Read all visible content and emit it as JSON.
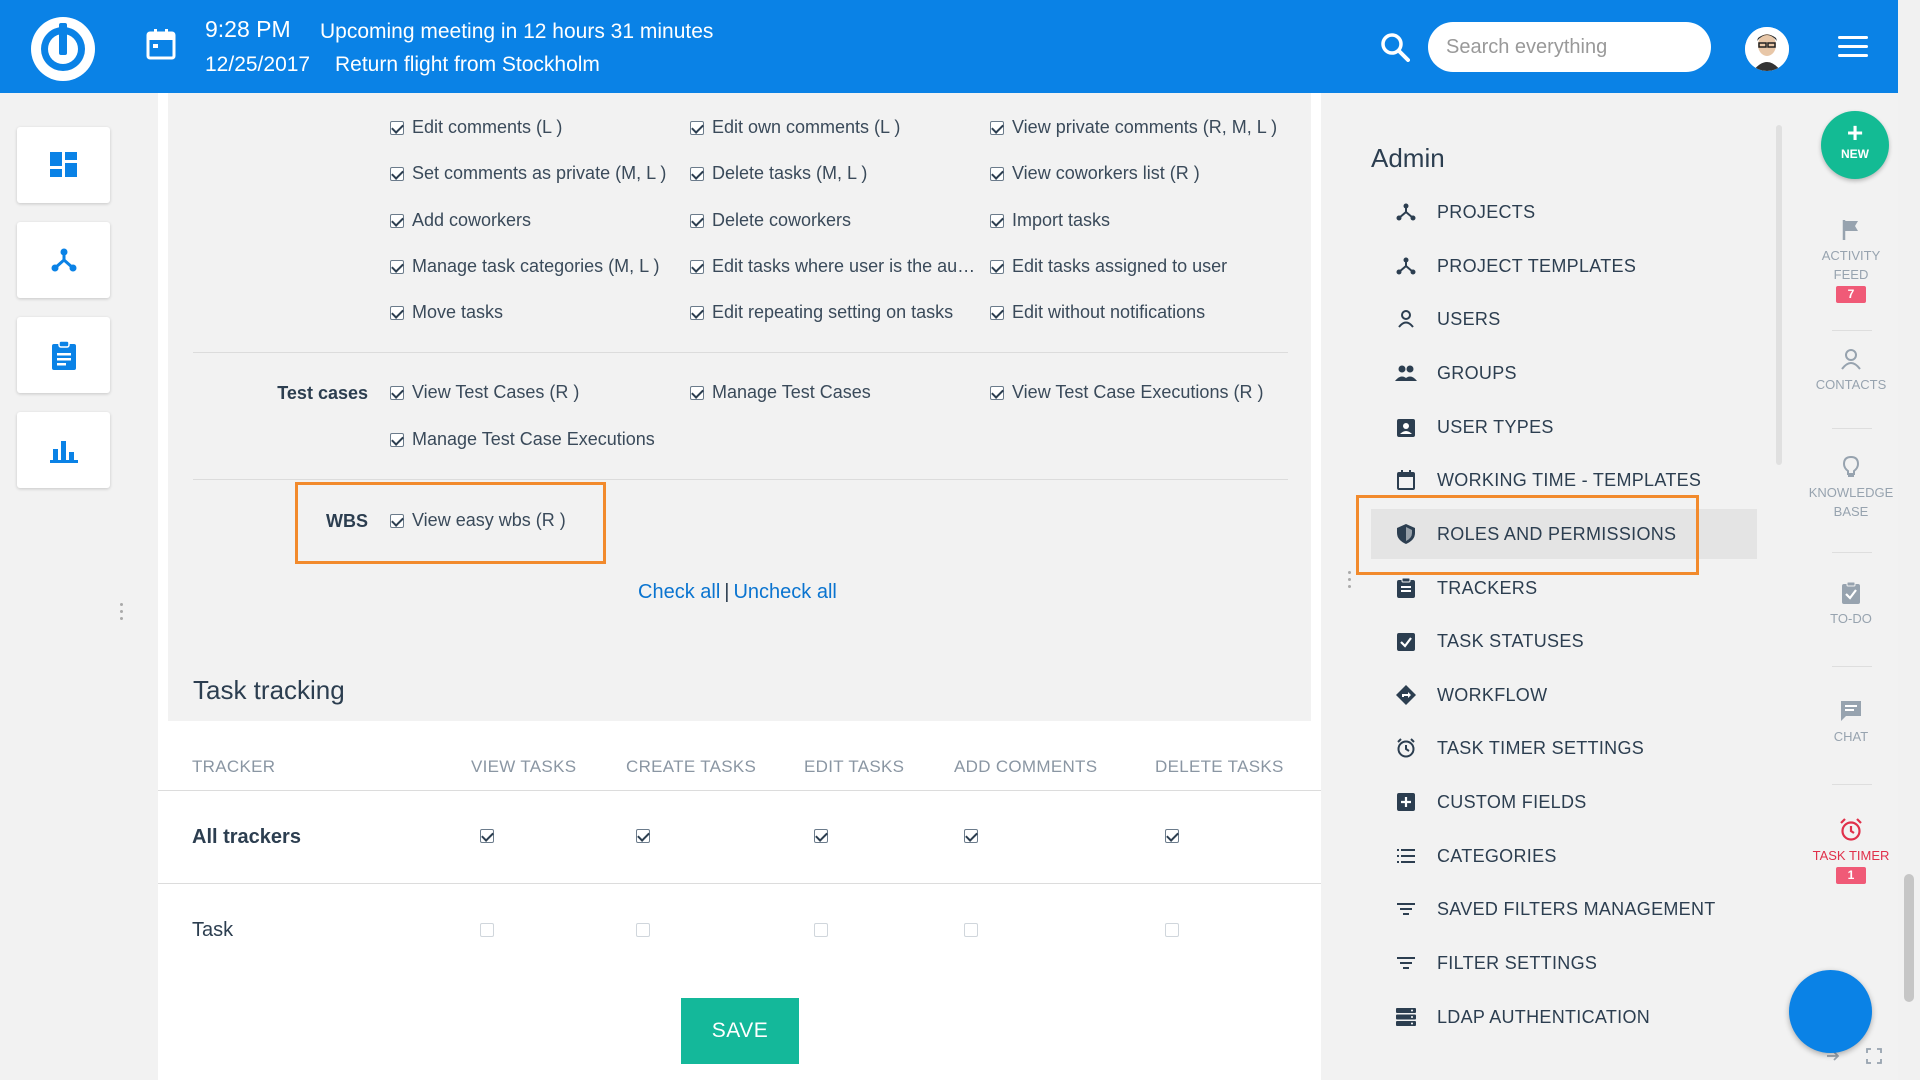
{
  "topbar": {
    "time": "9:28 PM",
    "meeting": "Upcoming meeting in 12 hours 31 minutes",
    "date": "12/25/2017",
    "flight": "Return flight from Stockholm",
    "search_placeholder": "Search everything",
    "colors": {
      "bar": "#0a82e6"
    }
  },
  "left_rail": {
    "items": [
      {
        "name": "dashboard-icon"
      },
      {
        "name": "projects-tree-icon"
      },
      {
        "name": "clipboard-icon"
      },
      {
        "name": "bar-chart-icon"
      }
    ]
  },
  "permissions": {
    "rows": [
      [
        "Edit comments (L )",
        "Edit own comments (L )",
        "View private comments (R, M, L )"
      ],
      [
        "Set comments as private (M, L )",
        "Delete tasks (M, L )",
        "View coworkers list (R )"
      ],
      [
        "Add coworkers",
        "Delete coworkers",
        "Import tasks"
      ],
      [
        "Manage task categories (M, L )",
        "Edit tasks where user is the au…",
        "Edit tasks assigned to user"
      ],
      [
        "Move tasks",
        "Edit repeating setting on tasks",
        "Edit without notifications"
      ]
    ],
    "test_cases": {
      "label": "Test cases",
      "items": [
        "View Test Cases (R )",
        "Manage Test Cases",
        "View Test Case Executions (R )",
        "Manage Test Case Executions"
      ]
    },
    "wbs": {
      "label": "WBS",
      "items": [
        "View easy wbs (R )"
      ]
    },
    "check_all": "Check all",
    "separator": "|",
    "uncheck_all": "Uncheck all"
  },
  "task_tracking": {
    "title": "Task tracking",
    "headers": [
      "TRACKER",
      "VIEW TASKS",
      "CREATE TASKS",
      "EDIT TASKS",
      "ADD COMMENTS",
      "DELETE TASKS"
    ],
    "rows": [
      {
        "label": "All trackers",
        "checked": [
          true,
          true,
          true,
          true,
          true
        ]
      },
      {
        "label": "Task",
        "checked": [
          false,
          false,
          false,
          false,
          false
        ]
      }
    ],
    "save": "SAVE"
  },
  "admin": {
    "title": "Admin",
    "items": [
      {
        "label": "PROJECTS",
        "icon": "projects-icon"
      },
      {
        "label": "PROJECT TEMPLATES",
        "icon": "project-templates-icon"
      },
      {
        "label": "USERS",
        "icon": "user-icon"
      },
      {
        "label": "GROUPS",
        "icon": "groups-icon"
      },
      {
        "label": "USER TYPES",
        "icon": "user-types-icon"
      },
      {
        "label": "WORKING TIME - TEMPLATES",
        "icon": "calendar-icon"
      },
      {
        "label": "ROLES AND PERMISSIONS",
        "icon": "shield-icon",
        "active": true
      },
      {
        "label": "TRACKERS",
        "icon": "trackers-icon"
      },
      {
        "label": "TASK STATUSES",
        "icon": "task-statuses-icon"
      },
      {
        "label": "WORKFLOW",
        "icon": "workflow-icon"
      },
      {
        "label": "TASK TIMER SETTINGS",
        "icon": "alarm-icon"
      },
      {
        "label": "CUSTOM FIELDS",
        "icon": "plus-box-icon"
      },
      {
        "label": "CATEGORIES",
        "icon": "list-icon"
      },
      {
        "label": "SAVED FILTERS MANAGEMENT",
        "icon": "filter-icon"
      },
      {
        "label": "FILTER SETTINGS",
        "icon": "filter-settings-icon"
      },
      {
        "label": "LDAP AUTHENTICATION",
        "icon": "server-icon"
      }
    ]
  },
  "right_rail": {
    "new_label": "NEW",
    "activity_feed": {
      "label1": "ACTIVITY",
      "label2": "FEED",
      "badge": "7"
    },
    "contacts": "CONTACTS",
    "knowledge": {
      "label1": "KNOWLEDGE",
      "label2": "BASE"
    },
    "todo": "TO-DO",
    "chat": "CHAT",
    "task_timer": {
      "label": "TASK TIMER",
      "badge": "1"
    }
  },
  "highlight_color": "#f28a2c"
}
